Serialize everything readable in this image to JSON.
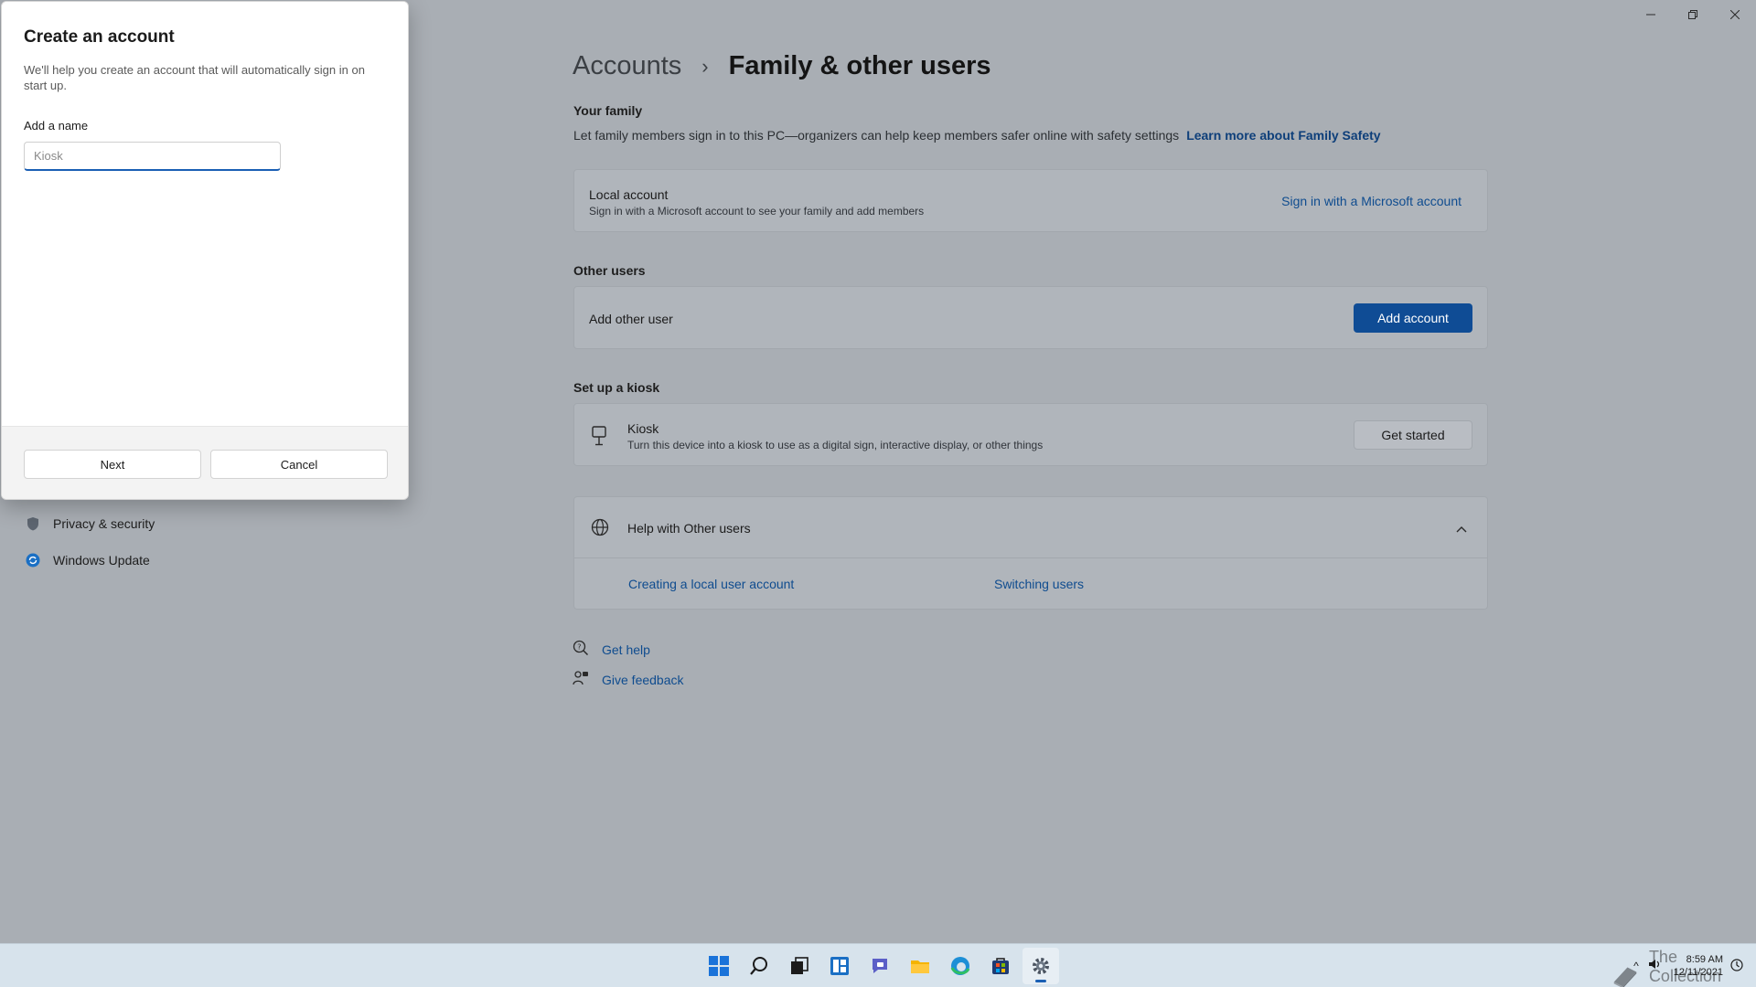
{
  "window": {
    "minimize_icon": "minimize-icon",
    "maximize_icon": "restore-icon",
    "close_icon": "close-icon"
  },
  "breadcrumb": {
    "parent": "Accounts",
    "separator": "›",
    "current": "Family & other users"
  },
  "your_family": {
    "title": "Your family",
    "description": "Let family members sign in to this PC—organizers can help keep members safer online with safety settings",
    "learn_more": "Learn more about Family Safety",
    "card_title": "Local account",
    "card_sub": "Sign in with a Microsoft account to see your family and add members",
    "sign_in_link": "Sign in with a Microsoft account"
  },
  "other_users": {
    "title": "Other users",
    "card_title": "Add other user",
    "add_button": "Add account"
  },
  "kiosk": {
    "title": "Set up a kiosk",
    "card_title": "Kiosk",
    "card_sub": "Turn this device into a kiosk to use as a digital sign, interactive display, or other things",
    "button": "Get started"
  },
  "help": {
    "title": "Help with Other users",
    "links": [
      "Creating a local user account",
      "Switching users"
    ]
  },
  "footer_links": {
    "get_help": "Get help",
    "give_feedback": "Give feedback"
  },
  "sidebar": {
    "items": [
      {
        "label": "Privacy & security",
        "icon": "shield-icon"
      },
      {
        "label": "Windows Update",
        "icon": "update-icon"
      }
    ]
  },
  "dialog": {
    "title": "Create an account",
    "description": "We'll help you create an account that will automatically sign in on start up.",
    "name_label": "Add a name",
    "name_placeholder": "Kiosk",
    "name_value": "",
    "next_button": "Next",
    "cancel_button": "Cancel"
  },
  "taskbar": {
    "icons": [
      "start-icon",
      "search-icon",
      "task-view-icon",
      "widgets-icon",
      "chat-icon",
      "file-explorer-icon",
      "edge-icon",
      "store-icon",
      "settings-icon"
    ],
    "time": "8:59 AM",
    "date": "12/11/2021",
    "watermark": "The Collection Book"
  },
  "colors": {
    "accent": "#0f4c95",
    "link": "#0e3f7a",
    "backdrop": "#a9aeb4"
  }
}
